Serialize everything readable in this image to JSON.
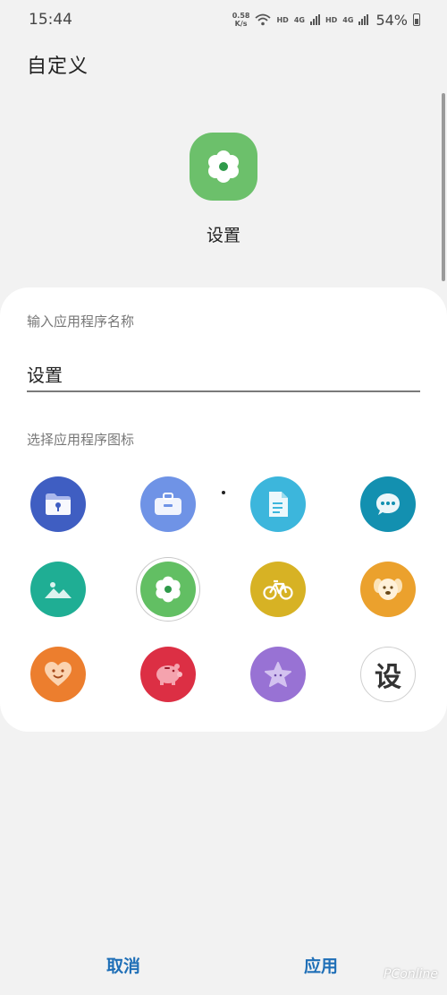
{
  "status_bar": {
    "time": "15:44",
    "net_speed_value": "0.58",
    "net_speed_unit": "K/s",
    "hd1": "HD",
    "net1": "4G",
    "hd2": "HD",
    "net2": "4G",
    "battery": "54%"
  },
  "header": {
    "title": "自定义"
  },
  "preview": {
    "label": "设置",
    "color": "#6cc06b"
  },
  "form": {
    "name_section_label": "输入应用程序名称",
    "name_value": "设置",
    "icon_section_label": "选择应用程序图标"
  },
  "icons": [
    {
      "name": "folder-lock-icon",
      "color": "#3f5ec2"
    },
    {
      "name": "briefcase-icon",
      "color": "#6f93e6"
    },
    {
      "name": "document-icon",
      "color": "#3cb6dc"
    },
    {
      "name": "chat-bubble-icon",
      "color": "#1390b0"
    },
    {
      "name": "landscape-icon",
      "color": "#1fae94"
    },
    {
      "name": "flower-icon",
      "color": "#62bf63",
      "selected": true
    },
    {
      "name": "bicycle-icon",
      "color": "#d7b224"
    },
    {
      "name": "puppy-icon",
      "color": "#eba12d"
    },
    {
      "name": "heart-face-icon",
      "color": "#ec7e2e"
    },
    {
      "name": "piggy-bank-icon",
      "color": "#dc2f44"
    },
    {
      "name": "star-icon",
      "color": "#9872d4"
    },
    {
      "name": "text-icon",
      "color": "#ffffff",
      "text": "设"
    }
  ],
  "buttons": {
    "cancel": "取消",
    "apply": "应用"
  },
  "watermark": "PConline"
}
